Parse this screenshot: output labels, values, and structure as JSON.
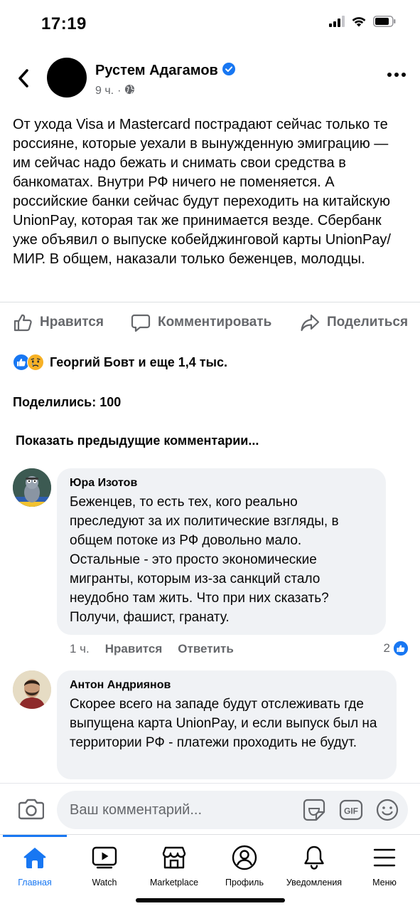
{
  "status_bar": {
    "time": "17:19"
  },
  "post": {
    "author": "Рустем Адагамов",
    "time": "9 ч.",
    "separator": "·",
    "text": "От ухода Visa и Mastercard пострадают сейчас только те россияне, которые уехали в вынужденную эмиграцию — им сейчас надо бежать и снимать свои средства в банкоматах. Внутри РФ ничего не поменяется. А российские банки сейчас будут переходить на китайскую UnionPay, которая так же принимается везде. Сбербанк уже объявил о выпуске кобейджинговой карты UnionPay/МИР. В общем, наказали только беженцев, молодцы."
  },
  "actions": {
    "like": "Нравится",
    "comment": "Комментировать",
    "share": "Поделиться"
  },
  "reactions": {
    "summary": "Георгий Бовт и еще 1,4 тыс."
  },
  "shares": {
    "label": "Поделились: 100"
  },
  "prev_comments": "Показать предыдущие комментарии...",
  "comments": [
    {
      "author": "Юра Изотов",
      "text": "Беженцев, то есть тех, кого реально преследуют за их политические взгляды, в общем потоке из РФ довольно мало. Остальные - это просто экономические мигранты, которым из-за санкций стало неудобно там жить. Что при них сказать? Получи, фашист, гранату.",
      "time": "1 ч.",
      "like": "Нравится",
      "reply": "Ответить",
      "likes_count": "2"
    },
    {
      "author": "Антон Андриянов",
      "text": "Скорее всего на западе будут отслеживать где выпущена карта UnionPay, и если выпуск был на территории РФ - платежи проходить не будут."
    }
  ],
  "composer": {
    "placeholder": "Ваш комментарий..."
  },
  "tabs": [
    {
      "label": "Главная",
      "icon": "home-icon"
    },
    {
      "label": "Watch",
      "icon": "watch-icon"
    },
    {
      "label": "Marketplace",
      "icon": "marketplace-icon"
    },
    {
      "label": "Профиль",
      "icon": "profile-icon"
    },
    {
      "label": "Уведомления",
      "icon": "bell-icon"
    },
    {
      "label": "Меню",
      "icon": "menu-icon"
    }
  ],
  "colors": {
    "brand_blue": "#1877f2",
    "secondary_text": "#65676b",
    "bubble_bg": "#f0f2f5"
  }
}
